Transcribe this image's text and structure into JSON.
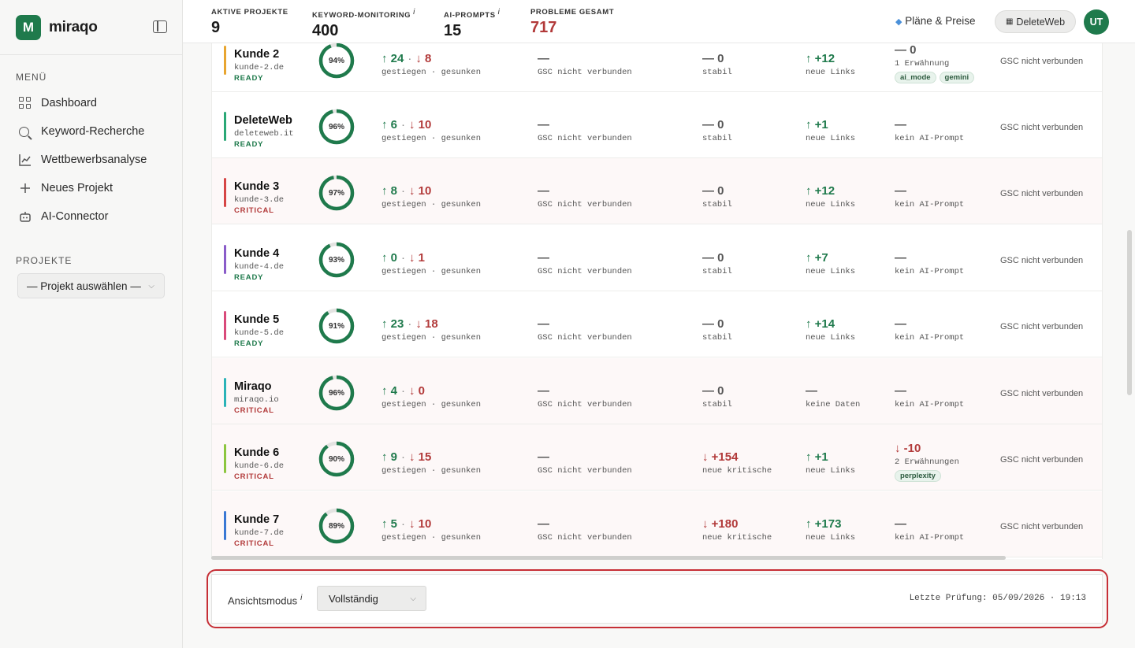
{
  "brand": {
    "name": "miraqo",
    "logo_letter": "M"
  },
  "sidebar": {
    "menu_title": "MENÜ",
    "items": [
      {
        "label": "Dashboard",
        "icon": "dashboard-grid-icon"
      },
      {
        "label": "Keyword-Recherche",
        "icon": "search-icon"
      },
      {
        "label": "Wettbewerbsanalyse",
        "icon": "line-chart-icon"
      },
      {
        "label": "Neues Projekt",
        "icon": "plus-icon"
      },
      {
        "label": "AI-Connector",
        "icon": "bot-icon"
      }
    ],
    "projects_title": "PROJEKTE",
    "project_select": "— Projekt auswählen —"
  },
  "topbar": {
    "stats": [
      {
        "label": "AKTIVE PROJEKTE",
        "info": "",
        "value": "9"
      },
      {
        "label": "KEYWORD-MONITORING",
        "info": "i",
        "value": "400"
      },
      {
        "label": "AI-PROMPTS",
        "info": "i",
        "value": "15"
      },
      {
        "label": "PROBLEME GESAMT",
        "info": "",
        "value": "717"
      }
    ],
    "plans_label": "Pläne & Preise",
    "workspace_label": "DeleteWeb",
    "avatar": "UT"
  },
  "table": {
    "rows": [
      {
        "name": "Kunde 2",
        "domain": "kunde-2.de",
        "status": "READY",
        "status_type": "ready",
        "color": "#e8a530",
        "score": 94,
        "kw_up": "↑ 24",
        "kw_down": "↓ 8",
        "kw_sub": "gestiegen · gesunken",
        "gsc_big": "—",
        "gsc_sub": "GSC nicht verbunden",
        "tech_big": "— 0",
        "tech_sub": "stabil",
        "tech_type": "neu",
        "links_big": "↑ +12",
        "links_sub": "neue Links",
        "links_type": "up",
        "ai_big": "— 0",
        "ai_sub": "1 Erwähnung",
        "ai_type": "neu",
        "tags": [
          "ai_mode",
          "gemini"
        ],
        "gsc_right": "GSC nicht verbunden"
      },
      {
        "name": "DeleteWeb",
        "domain": "deleteweb.it",
        "status": "READY",
        "status_type": "ready",
        "color": "#2aa876",
        "score": 96,
        "kw_up": "↑ 6",
        "kw_down": "↓ 10",
        "kw_sub": "gestiegen · gesunken",
        "gsc_big": "—",
        "gsc_sub": "GSC nicht verbunden",
        "tech_big": "— 0",
        "tech_sub": "stabil",
        "tech_type": "neu",
        "links_big": "↑ +1",
        "links_sub": "neue Links",
        "links_type": "up",
        "ai_big": "—",
        "ai_sub": "kein AI-Prompt",
        "ai_type": "neu",
        "tags": [],
        "gsc_right": "GSC nicht verbunden"
      },
      {
        "name": "Kunde 3",
        "domain": "kunde-3.de",
        "status": "CRITICAL",
        "status_type": "crit",
        "color": "#d64545",
        "score": 97,
        "kw_up": "↑ 8",
        "kw_down": "↓ 10",
        "kw_sub": "gestiegen · gesunken",
        "gsc_big": "—",
        "gsc_sub": "GSC nicht verbunden",
        "tech_big": "— 0",
        "tech_sub": "stabil",
        "tech_type": "neu",
        "links_big": "↑ +12",
        "links_sub": "neue Links",
        "links_type": "up",
        "ai_big": "—",
        "ai_sub": "kein AI-Prompt",
        "ai_type": "neu",
        "tags": [],
        "gsc_right": "GSC nicht verbunden"
      },
      {
        "name": "Kunde 4",
        "domain": "kunde-4.de",
        "status": "READY",
        "status_type": "ready",
        "color": "#8a5cc9",
        "score": 93,
        "kw_up": "↑ 0",
        "kw_down": "↓ 1",
        "kw_sub": "gestiegen · gesunken",
        "gsc_big": "—",
        "gsc_sub": "GSC nicht verbunden",
        "tech_big": "— 0",
        "tech_sub": "stabil",
        "tech_type": "neu",
        "links_big": "↑ +7",
        "links_sub": "neue Links",
        "links_type": "up",
        "ai_big": "—",
        "ai_sub": "kein AI-Prompt",
        "ai_type": "neu",
        "tags": [],
        "gsc_right": "GSC nicht verbunden"
      },
      {
        "name": "Kunde 5",
        "domain": "kunde-5.de",
        "status": "READY",
        "status_type": "ready",
        "color": "#d94a7a",
        "score": 91,
        "kw_up": "↑ 23",
        "kw_down": "↓ 18",
        "kw_sub": "gestiegen · gesunken",
        "gsc_big": "—",
        "gsc_sub": "GSC nicht verbunden",
        "tech_big": "— 0",
        "tech_sub": "stabil",
        "tech_type": "neu",
        "links_big": "↑ +14",
        "links_sub": "neue Links",
        "links_type": "up",
        "ai_big": "—",
        "ai_sub": "kein AI-Prompt",
        "ai_type": "neu",
        "tags": [],
        "gsc_right": "GSC nicht verbunden"
      },
      {
        "name": "Miraqo",
        "domain": "miraqo.io",
        "status": "CRITICAL",
        "status_type": "crit",
        "color": "#2bb3b8",
        "score": 96,
        "kw_up": "↑ 4",
        "kw_down": "↓ 0",
        "kw_sub": "gestiegen · gesunken",
        "gsc_big": "—",
        "gsc_sub": "GSC nicht verbunden",
        "tech_big": "— 0",
        "tech_sub": "stabil",
        "tech_type": "neu",
        "links_big": "—",
        "links_sub": "keine Daten",
        "links_type": "neu",
        "ai_big": "—",
        "ai_sub": "kein AI-Prompt",
        "ai_type": "neu",
        "tags": [],
        "gsc_right": "GSC nicht verbunden"
      },
      {
        "name": "Kunde 6",
        "domain": "kunde-6.de",
        "status": "CRITICAL",
        "status_type": "crit",
        "color": "#8cc63f",
        "score": 90,
        "kw_up": "↑ 9",
        "kw_down": "↓ 15",
        "kw_sub": "gestiegen · gesunken",
        "gsc_big": "—",
        "gsc_sub": "GSC nicht verbunden",
        "tech_big": "↓ +154",
        "tech_sub": "neue kritische",
        "tech_type": "dn",
        "links_big": "↑ +1",
        "links_sub": "neue Links",
        "links_type": "up",
        "ai_big": "↓ -10",
        "ai_sub": "2 Erwähnungen",
        "ai_type": "dn",
        "tags": [
          "perplexity"
        ],
        "gsc_right": "GSC nicht verbunden"
      },
      {
        "name": "Kunde 7",
        "domain": "kunde-7.de",
        "status": "CRITICAL",
        "status_type": "crit",
        "color": "#3a78d4",
        "score": 89,
        "kw_up": "↑ 5",
        "kw_down": "↓ 10",
        "kw_sub": "gestiegen · gesunken",
        "gsc_big": "—",
        "gsc_sub": "GSC nicht verbunden",
        "tech_big": "↓ +180",
        "tech_sub": "neue kritische",
        "tech_type": "dn",
        "links_big": "↑ +173",
        "links_sub": "neue Links",
        "links_type": "up",
        "ai_big": "—",
        "ai_sub": "kein AI-Prompt",
        "ai_type": "neu",
        "tags": [],
        "gsc_right": "GSC nicht verbunden"
      }
    ]
  },
  "footer": {
    "view_label": "Ansichtsmodus",
    "view_info": "i",
    "view_value": "Vollständig",
    "last_check": "Letzte Prüfung: 05/09/2026 · 19:13"
  }
}
